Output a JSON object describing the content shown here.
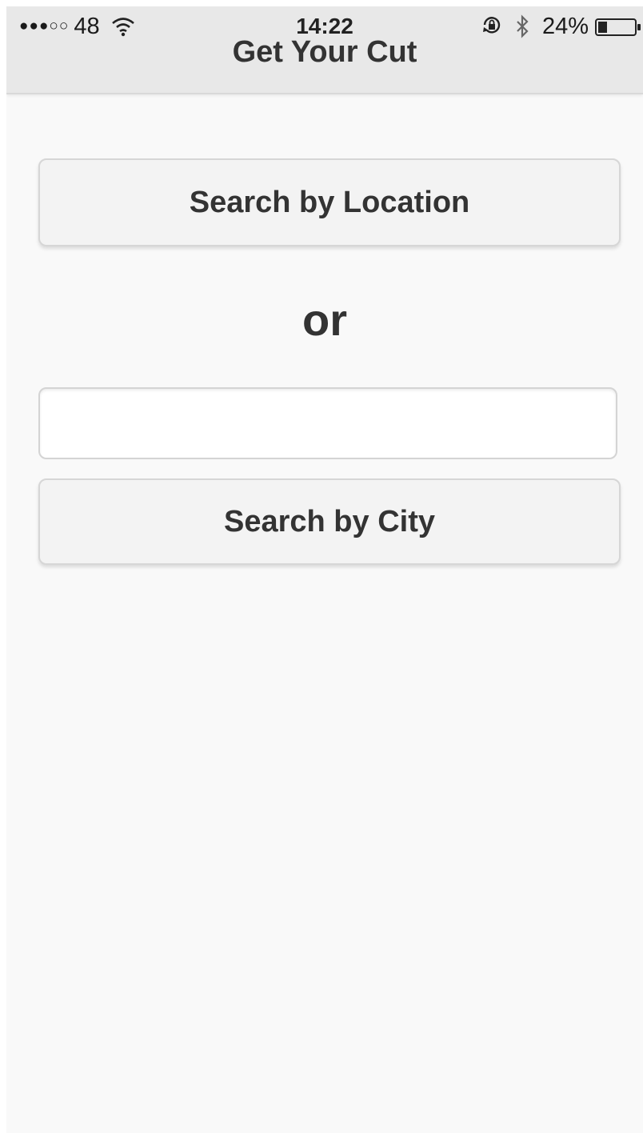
{
  "status_bar": {
    "carrier_signal": "●●●○○",
    "network": "48",
    "time": "14:22",
    "battery_percent": "24%",
    "battery_level": 0.24
  },
  "nav": {
    "title": "Get Your Cut"
  },
  "main": {
    "location_button_label": "Search by Location",
    "or_label": "or",
    "city_input": {
      "value": "",
      "placeholder": ""
    },
    "city_button_label": "Search by City"
  },
  "icons": {
    "wifi": "wifi-icon",
    "rotation_lock": "rotation-lock-icon",
    "bluetooth": "bluetooth-icon",
    "battery": "battery-icon"
  },
  "colors": {
    "header_bg": "#e8e8e8",
    "page_bg": "#f9f9f9",
    "text": "#333333",
    "button_bg": "#f3f3f3",
    "button_border": "#d6d6d6"
  }
}
